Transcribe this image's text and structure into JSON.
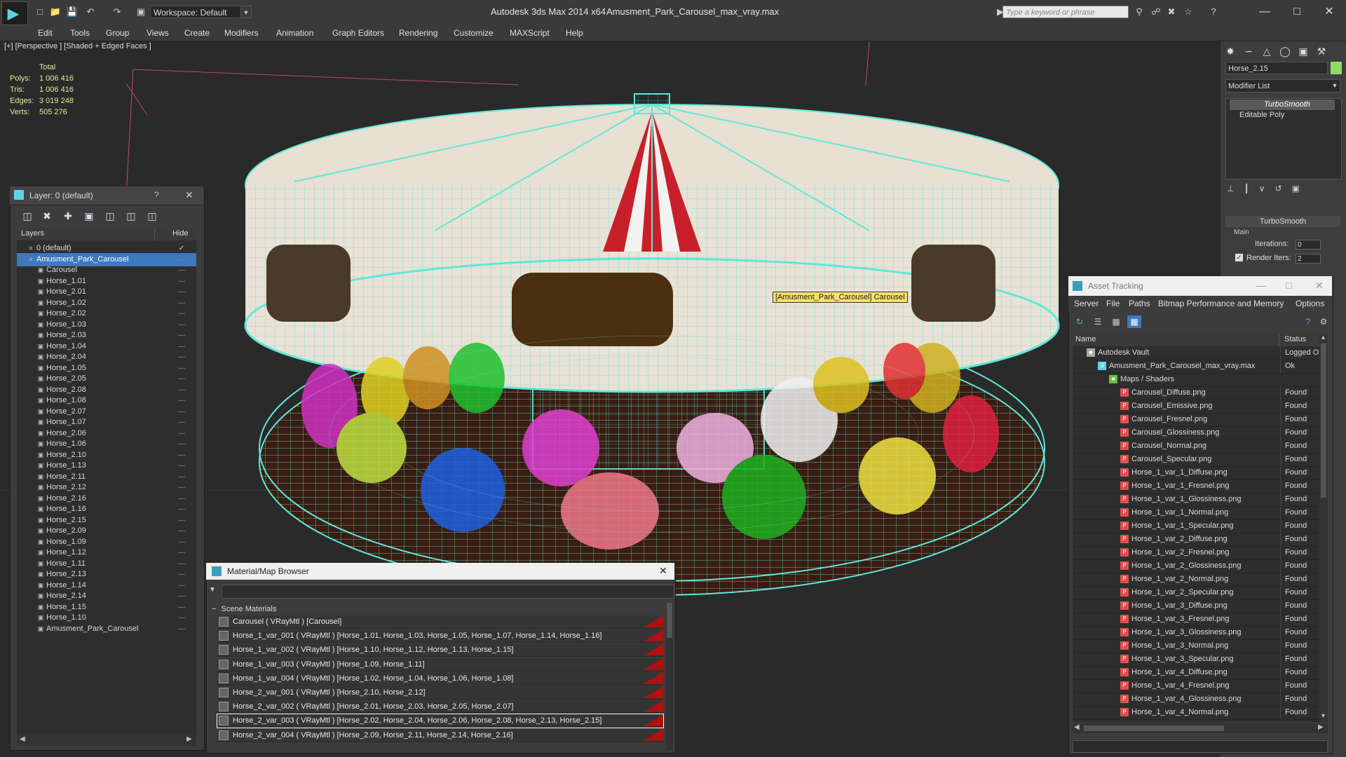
{
  "titlebar": {
    "workspace": "Workspace: Default",
    "app_title": "Autodesk 3ds Max  2014 x64",
    "doc_title": "Amusment_Park_Carousel_max_vray.max",
    "search_placeholder": "Type a keyword or phrase"
  },
  "menu": [
    "Edit",
    "Tools",
    "Group",
    "Views",
    "Create",
    "Modifiers",
    "Animation",
    "Graph Editors",
    "Rendering",
    "Customize",
    "MAXScript",
    "Help"
  ],
  "viewport": {
    "label": "[+] [Perspective ] [Shaded + Edged Faces ]",
    "stats_header": "Total",
    "stats": [
      {
        "label": "Polys:",
        "value": "1 006 416"
      },
      {
        "label": "Tris:",
        "value": "1 006 416"
      },
      {
        "label": "Edges:",
        "value": "3 019 248"
      },
      {
        "label": "Verts:",
        "value": "505 276"
      }
    ],
    "tooltip": "[Amusment_Park_Carousel] Carousel"
  },
  "command_panel": {
    "object_name": "Horse_2.15",
    "modifier_list": "Modifier List",
    "stack": [
      "TurboSmooth",
      "Editable Poly"
    ],
    "rollout_title": "TurboSmooth",
    "main_label": "Main",
    "iterations_label": "Iterations:",
    "iterations_value": "0",
    "render_iters_label": "Render Iters:",
    "render_iters_value": "2"
  },
  "layer_panel": {
    "title": "Layer: 0 (default)",
    "col_layers": "Layers",
    "col_hide": "Hide",
    "rows": [
      {
        "label": "0 (default)",
        "indent": 0,
        "selected": false
      },
      {
        "label": "Amusment_Park_Carousel",
        "indent": 0,
        "selected": true
      },
      {
        "label": "Carousel",
        "indent": 1,
        "selected": false
      },
      {
        "label": "Horse_1.01",
        "indent": 1,
        "selected": false
      },
      {
        "label": "Horse_2.01",
        "indent": 1,
        "selected": false
      },
      {
        "label": "Horse_1.02",
        "indent": 1,
        "selected": false
      },
      {
        "label": "Horse_2.02",
        "indent": 1,
        "selected": false
      },
      {
        "label": "Horse_1.03",
        "indent": 1,
        "selected": false
      },
      {
        "label": "Horse_2.03",
        "indent": 1,
        "selected": false
      },
      {
        "label": "Horse_1.04",
        "indent": 1,
        "selected": false
      },
      {
        "label": "Horse_2.04",
        "indent": 1,
        "selected": false
      },
      {
        "label": "Horse_1.05",
        "indent": 1,
        "selected": false
      },
      {
        "label": "Horse_2.05",
        "indent": 1,
        "selected": false
      },
      {
        "label": "Horse_2.08",
        "indent": 1,
        "selected": false
      },
      {
        "label": "Horse_1.08",
        "indent": 1,
        "selected": false
      },
      {
        "label": "Horse_2.07",
        "indent": 1,
        "selected": false
      },
      {
        "label": "Horse_1.07",
        "indent": 1,
        "selected": false
      },
      {
        "label": "Horse_2.06",
        "indent": 1,
        "selected": false
      },
      {
        "label": "Horse_1.06",
        "indent": 1,
        "selected": false
      },
      {
        "label": "Horse_2.10",
        "indent": 1,
        "selected": false
      },
      {
        "label": "Horse_1.13",
        "indent": 1,
        "selected": false
      },
      {
        "label": "Horse_2.11",
        "indent": 1,
        "selected": false
      },
      {
        "label": "Horse_2.12",
        "indent": 1,
        "selected": false
      },
      {
        "label": "Horse_2.16",
        "indent": 1,
        "selected": false
      },
      {
        "label": "Horse_1.16",
        "indent": 1,
        "selected": false
      },
      {
        "label": "Horse_2.15",
        "indent": 1,
        "selected": false
      },
      {
        "label": "Horse_2.09",
        "indent": 1,
        "selected": false
      },
      {
        "label": "Horse_1.09",
        "indent": 1,
        "selected": false
      },
      {
        "label": "Horse_1.12",
        "indent": 1,
        "selected": false
      },
      {
        "label": "Horse_1.11",
        "indent": 1,
        "selected": false
      },
      {
        "label": "Horse_2.13",
        "indent": 1,
        "selected": false
      },
      {
        "label": "Horse_1.14",
        "indent": 1,
        "selected": false
      },
      {
        "label": "Horse_2.14",
        "indent": 1,
        "selected": false
      },
      {
        "label": "Horse_1.15",
        "indent": 1,
        "selected": false
      },
      {
        "label": "Horse_1.10",
        "indent": 1,
        "selected": false
      },
      {
        "label": "Amusment_Park_Carousel",
        "indent": 1,
        "selected": false
      }
    ]
  },
  "material_browser": {
    "title": "Material/Map Browser",
    "group": "Scene Materials",
    "rows": [
      "Carousel  ( VRayMtl )  [Carousel]",
      "Horse_1_var_001  ( VRayMtl )  [Horse_1.01, Horse_1.03, Horse_1.05, Horse_1.07, Horse_1.14, Horse_1.16]",
      "Horse_1_var_002  ( VRayMtl )  [Horse_1.10, Horse_1.12, Horse_1.13, Horse_1.15]",
      "Horse_1_var_003  ( VRayMtl )  [Horse_1.09, Horse_1.11]",
      "Horse_1_var_004  ( VRayMtl )  [Horse_1.02, Horse_1.04, Horse_1.06, Horse_1.08]",
      "Horse_2_var_001  ( VRayMtl )  [Horse_2.10, Horse_2.12]",
      "Horse_2_var_002  ( VRayMtl )  [Horse_2.01, Horse_2.03, Horse_2.05, Horse_2.07]",
      "Horse_2_var_003  ( VRayMtl )  [Horse_2.02, Horse_2.04, Horse_2.06, Horse_2.08, Horse_2.13, Horse_2.15]",
      "Horse_2_var_004  ( VRayMtl )  [Horse_2.09, Horse_2.11, Horse_2.14, Horse_2.16]"
    ],
    "selected_index": 7
  },
  "asset_tracking": {
    "title": "Asset Tracking",
    "menu": [
      "Server",
      "File",
      "Paths",
      "Bitmap Performance and Memory",
      "Options"
    ],
    "col_name": "Name",
    "col_status": "Status",
    "rows": [
      {
        "name": "Autodesk Vault",
        "status": "Logged Ou",
        "level": 0,
        "icon": "vault"
      },
      {
        "name": "Amusment_Park_Carousel_max_vray.max",
        "status": "Ok",
        "level": 1,
        "icon": "max"
      },
      {
        "name": "Maps / Shaders",
        "status": "",
        "level": 2,
        "icon": "folder"
      },
      {
        "name": "Carousel_Diffuse.png",
        "status": "Found",
        "level": 3,
        "icon": "png"
      },
      {
        "name": "Carousel_Emissive.png",
        "status": "Found",
        "level": 3,
        "icon": "png"
      },
      {
        "name": "Carousel_Fresnel.png",
        "status": "Found",
        "level": 3,
        "icon": "png"
      },
      {
        "name": "Carousel_Glossiness.png",
        "status": "Found",
        "level": 3,
        "icon": "png"
      },
      {
        "name": "Carousel_Normal.png",
        "status": "Found",
        "level": 3,
        "icon": "png"
      },
      {
        "name": "Carousel_Specular.png",
        "status": "Found",
        "level": 3,
        "icon": "png"
      },
      {
        "name": "Horse_1_var_1_Diffuse.png",
        "status": "Found",
        "level": 3,
        "icon": "png"
      },
      {
        "name": "Horse_1_var_1_Fresnel.png",
        "status": "Found",
        "level": 3,
        "icon": "png"
      },
      {
        "name": "Horse_1_var_1_Glossiness.png",
        "status": "Found",
        "level": 3,
        "icon": "png"
      },
      {
        "name": "Horse_1_var_1_Normal.png",
        "status": "Found",
        "level": 3,
        "icon": "png"
      },
      {
        "name": "Horse_1_var_1_Specular.png",
        "status": "Found",
        "level": 3,
        "icon": "png"
      },
      {
        "name": "Horse_1_var_2_Diffuse.png",
        "status": "Found",
        "level": 3,
        "icon": "png"
      },
      {
        "name": "Horse_1_var_2_Fresnel.png",
        "status": "Found",
        "level": 3,
        "icon": "png"
      },
      {
        "name": "Horse_1_var_2_Glossiness.png",
        "status": "Found",
        "level": 3,
        "icon": "png"
      },
      {
        "name": "Horse_1_var_2_Normal.png",
        "status": "Found",
        "level": 3,
        "icon": "png"
      },
      {
        "name": "Horse_1_var_2_Specular.png",
        "status": "Found",
        "level": 3,
        "icon": "png"
      },
      {
        "name": "Horse_1_var_3_Diffuse.png",
        "status": "Found",
        "level": 3,
        "icon": "png"
      },
      {
        "name": "Horse_1_var_3_Fresnel.png",
        "status": "Found",
        "level": 3,
        "icon": "png"
      },
      {
        "name": "Horse_1_var_3_Glossiness.png",
        "status": "Found",
        "level": 3,
        "icon": "png"
      },
      {
        "name": "Horse_1_var_3_Normal.png",
        "status": "Found",
        "level": 3,
        "icon": "png"
      },
      {
        "name": "Horse_1_var_3_Specular.png",
        "status": "Found",
        "level": 3,
        "icon": "png"
      },
      {
        "name": "Horse_1_var_4_Diffuse.png",
        "status": "Found",
        "level": 3,
        "icon": "png"
      },
      {
        "name": "Horse_1_var_4_Fresnel.png",
        "status": "Found",
        "level": 3,
        "icon": "png"
      },
      {
        "name": "Horse_1_var_4_Glossiness.png",
        "status": "Found",
        "level": 3,
        "icon": "png"
      },
      {
        "name": "Horse_1_var_4_Normal.png",
        "status": "Found",
        "level": 3,
        "icon": "png"
      }
    ]
  },
  "colors": {
    "selection": "#3e78bd",
    "wireframe": "#5fe8d8",
    "material_flag": "#b01010"
  }
}
